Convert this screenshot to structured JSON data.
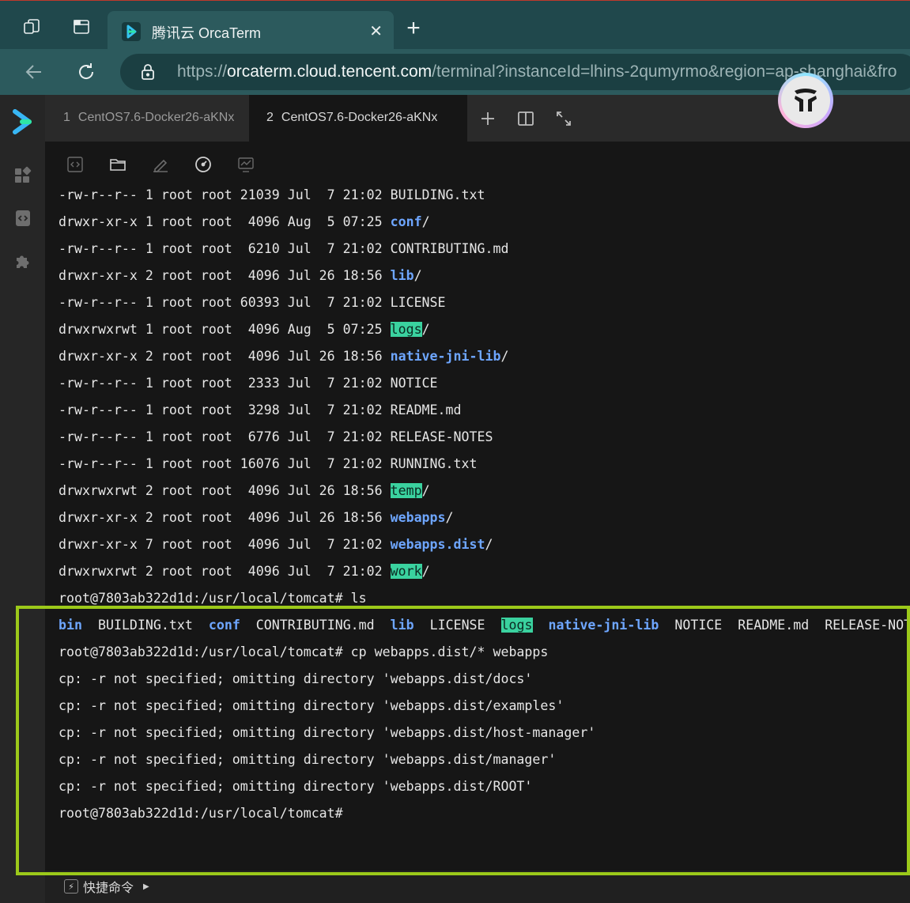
{
  "browser": {
    "tab_title": "腾讯云 OrcaTerm",
    "close_glyph": "✕",
    "new_tab_glyph": "+",
    "url_prefix": "https://",
    "url_host": "orcaterm.cloud.tencent.com",
    "url_path": "/terminal?instanceId=lhins-2qumyrmo&region=ap-shanghai&fro"
  },
  "terminal_tabs": [
    {
      "num": "1",
      "label": "CentOS7.6-Docker26-aKNx"
    },
    {
      "num": "2",
      "label": "CentOS7.6-Docker26-aKNx"
    }
  ],
  "listing": [
    {
      "perm": "-rw-r--r-- 1 root root 21039 Jul  7 21:02 ",
      "name": "BUILDING.txt",
      "type": "file"
    },
    {
      "perm": "drwxr-xr-x 1 root root  4096 Aug  5 07:25 ",
      "name": "conf",
      "type": "dir"
    },
    {
      "perm": "-rw-r--r-- 1 root root  6210 Jul  7 21:02 ",
      "name": "CONTRIBUTING.md",
      "type": "file"
    },
    {
      "perm": "drwxr-xr-x 2 root root  4096 Jul 26 18:56 ",
      "name": "lib",
      "type": "dir"
    },
    {
      "perm": "-rw-r--r-- 1 root root 60393 Jul  7 21:02 ",
      "name": "LICENSE",
      "type": "file"
    },
    {
      "perm": "drwxrwxrwt 1 root root  4096 Aug  5 07:25 ",
      "name": "logs",
      "type": "hl"
    },
    {
      "perm": "drwxr-xr-x 2 root root  4096 Jul 26 18:56 ",
      "name": "native-jni-lib",
      "type": "dir"
    },
    {
      "perm": "-rw-r--r-- 1 root root  2333 Jul  7 21:02 ",
      "name": "NOTICE",
      "type": "file"
    },
    {
      "perm": "-rw-r--r-- 1 root root  3298 Jul  7 21:02 ",
      "name": "README.md",
      "type": "file"
    },
    {
      "perm": "-rw-r--r-- 1 root root  6776 Jul  7 21:02 ",
      "name": "RELEASE-NOTES",
      "type": "file"
    },
    {
      "perm": "-rw-r--r-- 1 root root 16076 Jul  7 21:02 ",
      "name": "RUNNING.txt",
      "type": "file"
    },
    {
      "perm": "drwxrwxrwt 2 root root  4096 Jul 26 18:56 ",
      "name": "temp",
      "type": "hl"
    },
    {
      "perm": "drwxr-xr-x 2 root root  4096 Jul 26 18:56 ",
      "name": "webapps",
      "type": "dir"
    },
    {
      "perm": "drwxr-xr-x 7 root root  4096 Jul  7 21:02 ",
      "name": "webapps.dist",
      "type": "dir"
    },
    {
      "perm": "drwxrwxrwt 2 root root  4096 Jul  7 21:02 ",
      "name": "work",
      "type": "hl"
    }
  ],
  "prompt_ls": "root@7803ab322d1d:/usr/local/tomcat# ls",
  "ls_short": [
    {
      "name": "bin",
      "type": "dir"
    },
    {
      "name": "BUILDING.txt",
      "type": "file"
    },
    {
      "name": "conf",
      "type": "dir"
    },
    {
      "name": "CONTRIBUTING.md",
      "type": "file"
    },
    {
      "name": "lib",
      "type": "dir"
    },
    {
      "name": "LICENSE",
      "type": "file"
    },
    {
      "name": "logs",
      "type": "hl"
    },
    {
      "name": "native-jni-lib",
      "type": "dir"
    },
    {
      "name": "NOTICE",
      "type": "file"
    },
    {
      "name": "README.md",
      "type": "file"
    },
    {
      "name": "RELEASE-NOTES",
      "type": "file"
    }
  ],
  "prompt_cp": "root@7803ab322d1d:/usr/local/tomcat# cp webapps.dist/* webapps",
  "cp_errors": [
    "cp: -r not specified; omitting directory 'webapps.dist/docs'",
    "cp: -r not specified; omitting directory 'webapps.dist/examples'",
    "cp: -r not specified; omitting directory 'webapps.dist/host-manager'",
    "cp: -r not specified; omitting directory 'webapps.dist/manager'",
    "cp: -r not specified; omitting directory 'webapps.dist/ROOT'"
  ],
  "prompt_final": "root@7803ab322d1d:/usr/local/tomcat#",
  "shortcut_label": "快捷命令",
  "colors": {
    "dir": "#6ea6ff",
    "highlight_bg": "#3ad29f",
    "frame": "#9cc91a"
  }
}
